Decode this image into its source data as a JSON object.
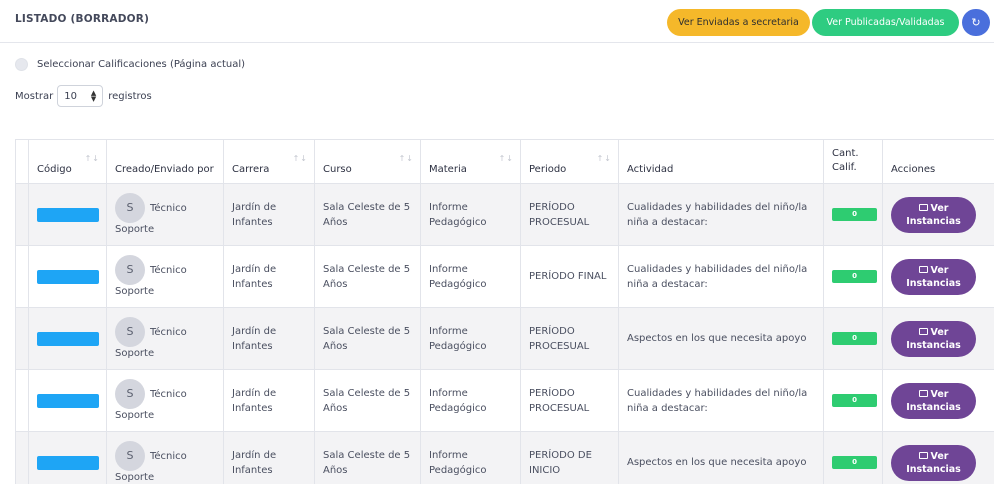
{
  "header": {
    "title": "LISTADO (BORRADOR)",
    "btn_sent": "Ver Enviadas a secretaria",
    "btn_published": "Ver Publicadas/Validadas",
    "refresh_icon": "refresh-icon"
  },
  "controls": {
    "select_all_label": "Seleccionar Calificaciones (Página actual)",
    "show_label": "Mostrar",
    "page_length": "10",
    "records_label": "registros"
  },
  "table": {
    "columns": [
      "Código",
      "Creado/Enviado por",
      "Carrera",
      "Curso",
      "Materia",
      "Periodo",
      "Actividad",
      "Cant. Calif.",
      "Acciones"
    ],
    "rows": [
      {
        "avatar": "S",
        "creator": "Técnico",
        "creator2": "Soporte",
        "career": "Jardín de Infantes",
        "course": "Sala Celeste de 5 Años",
        "subject": "Informe Pedagógico",
        "period": "PERÍODO PROCESUAL",
        "activity": "Cualidades y habilidades del niño/la niña a destacar:",
        "count": "0",
        "action": "Ver Instancias"
      },
      {
        "avatar": "S",
        "creator": "Técnico",
        "creator2": "Soporte",
        "career": "Jardín de Infantes",
        "course": "Sala Celeste de 5 Años",
        "subject": "Informe Pedagógico",
        "period": "PERÍODO FINAL",
        "activity": "Cualidades y habilidades del niño/la niña a destacar:",
        "count": "0",
        "action": "Ver Instancias"
      },
      {
        "avatar": "S",
        "creator": "Técnico",
        "creator2": "Soporte",
        "career": "Jardín de Infantes",
        "course": "Sala Celeste de 5 Años",
        "subject": "Informe Pedagógico",
        "period": "PERÍODO PROCESUAL",
        "activity": "Aspectos en los que necesita apoyo",
        "count": "0",
        "action": "Ver Instancias"
      },
      {
        "avatar": "S",
        "creator": "Técnico",
        "creator2": "Soporte",
        "career": "Jardín de Infantes",
        "course": "Sala Celeste de 5 Años",
        "subject": "Informe Pedagógico",
        "period": "PERÍODO PROCESUAL",
        "activity": "Cualidades y habilidades del niño/la niña a destacar:",
        "count": "0",
        "action": "Ver Instancias"
      },
      {
        "avatar": "S",
        "creator": "Técnico",
        "creator2": "Soporte",
        "career": "Jardín de Infantes",
        "course": "Sala Celeste de 5 Años",
        "subject": "Informe Pedagógico",
        "period": "PERÍODO DE INICIO",
        "activity": "Aspectos en los que necesita apoyo",
        "count": "0",
        "action": "Ver Instancias"
      }
    ]
  },
  "colors": {
    "accent_yellow": "#f5b82a",
    "accent_green": "#2ecc81",
    "accent_blue": "#4a6fdc",
    "action_purple": "#6f4596",
    "code_blue": "#1ea5f5"
  }
}
